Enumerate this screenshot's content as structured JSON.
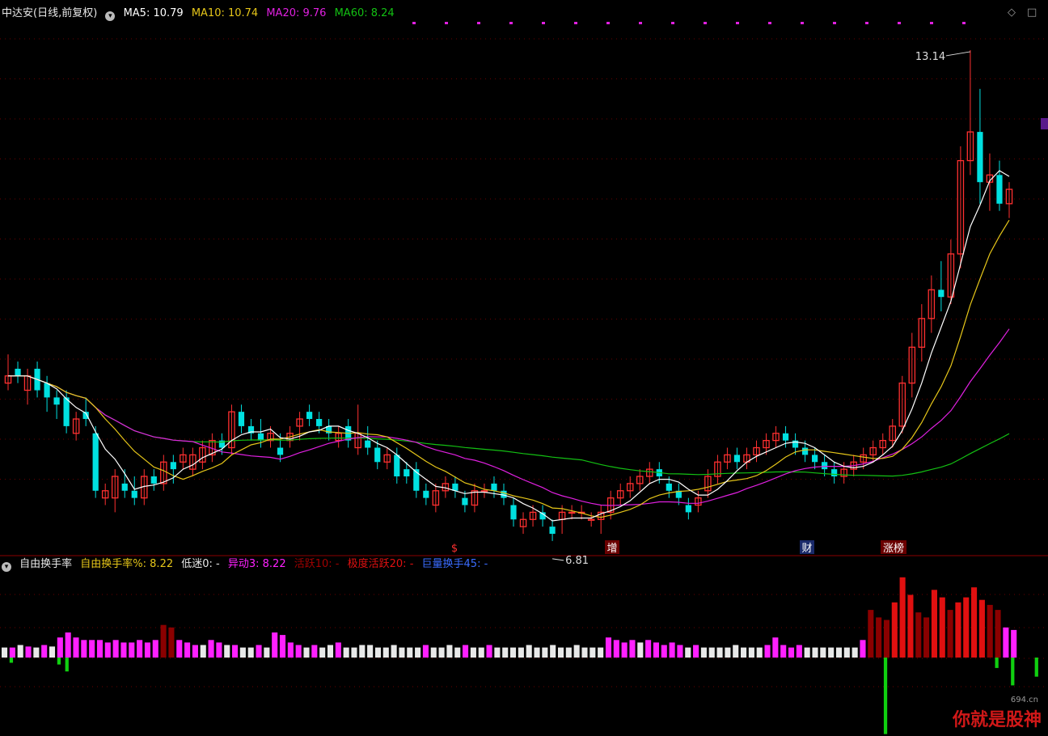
{
  "header": {
    "stock": "中达安(日线,前复权)",
    "ma5": "MA5: 10.79",
    "ma10": "MA10: 10.74",
    "ma20": "MA20: 9.76",
    "ma60": "MA60: 8.24"
  },
  "sub_header": {
    "indicator": "自由换手率",
    "rate": "自由换手率%: 8.22",
    "low": "低迷0: -",
    "abnormal": "异动3: 8.22",
    "active": "活跃10: -",
    "very_active": "极度活跃20: -",
    "huge": "巨量换手45: -"
  },
  "annotations": {
    "high": "13.14",
    "low": "6.81",
    "events": [
      "$",
      "增",
      "财",
      "涨榜"
    ]
  },
  "controls": {
    "diamond": "◇",
    "window": "□"
  },
  "watermark": {
    "text": "你就是股神",
    "site": "694.cn"
  },
  "colors": {
    "bg": "#000000",
    "up": "#ff3030",
    "down": "#00e0e0",
    "ma5": "#ffffff",
    "ma10": "#e6c619",
    "ma20": "#e020e0",
    "ma60": "#13c013",
    "grid": "#6a0000",
    "turnover_magenta": "#ff20ff",
    "turnover_white": "#e8e8e8",
    "turnover_darkred": "#8b0000",
    "turnover_red": "#e01010"
  },
  "chart_data": {
    "type": "candlestick",
    "price_ylim": [
      6.4,
      13.5
    ],
    "candles": [
      {
        "o": 8.5,
        "h": 8.9,
        "l": 8.4,
        "c": 8.6
      },
      {
        "o": 8.7,
        "h": 8.8,
        "l": 8.5,
        "c": 8.6
      },
      {
        "o": 8.4,
        "h": 8.7,
        "l": 8.2,
        "c": 8.6
      },
      {
        "o": 8.7,
        "h": 8.8,
        "l": 8.3,
        "c": 8.4
      },
      {
        "o": 8.5,
        "h": 8.6,
        "l": 8.1,
        "c": 8.3
      },
      {
        "o": 8.3,
        "h": 8.4,
        "l": 8.0,
        "c": 8.2
      },
      {
        "o": 8.3,
        "h": 8.4,
        "l": 7.8,
        "c": 7.9
      },
      {
        "o": 7.8,
        "h": 8.1,
        "l": 7.7,
        "c": 8.0
      },
      {
        "o": 8.1,
        "h": 8.3,
        "l": 7.9,
        "c": 8.0
      },
      {
        "o": 7.8,
        "h": 7.9,
        "l": 6.9,
        "c": 7.0
      },
      {
        "o": 6.9,
        "h": 7.1,
        "l": 6.8,
        "c": 7.0
      },
      {
        "o": 6.9,
        "h": 7.3,
        "l": 6.7,
        "c": 7.2
      },
      {
        "o": 7.1,
        "h": 7.3,
        "l": 6.9,
        "c": 7.0
      },
      {
        "o": 7.0,
        "h": 7.2,
        "l": 6.8,
        "c": 6.9
      },
      {
        "o": 6.9,
        "h": 7.3,
        "l": 6.8,
        "c": 7.2
      },
      {
        "o": 7.2,
        "h": 7.3,
        "l": 7.0,
        "c": 7.1
      },
      {
        "o": 7.1,
        "h": 7.5,
        "l": 7.0,
        "c": 7.4
      },
      {
        "o": 7.4,
        "h": 7.5,
        "l": 7.1,
        "c": 7.3
      },
      {
        "o": 7.4,
        "h": 7.6,
        "l": 7.3,
        "c": 7.5
      },
      {
        "o": 7.3,
        "h": 7.6,
        "l": 7.2,
        "c": 7.5
      },
      {
        "o": 7.4,
        "h": 7.7,
        "l": 7.3,
        "c": 7.6
      },
      {
        "o": 7.5,
        "h": 7.8,
        "l": 7.4,
        "c": 7.7
      },
      {
        "o": 7.7,
        "h": 7.8,
        "l": 7.5,
        "c": 7.6
      },
      {
        "o": 7.6,
        "h": 8.2,
        "l": 7.5,
        "c": 8.1
      },
      {
        "o": 8.1,
        "h": 8.2,
        "l": 7.8,
        "c": 7.9
      },
      {
        "o": 7.9,
        "h": 8.0,
        "l": 7.7,
        "c": 7.8
      },
      {
        "o": 7.8,
        "h": 8.0,
        "l": 7.6,
        "c": 7.7
      },
      {
        "o": 7.7,
        "h": 7.9,
        "l": 7.6,
        "c": 7.8
      },
      {
        "o": 7.6,
        "h": 7.8,
        "l": 7.4,
        "c": 7.5
      },
      {
        "o": 7.7,
        "h": 7.9,
        "l": 7.6,
        "c": 7.8
      },
      {
        "o": 7.9,
        "h": 8.1,
        "l": 7.7,
        "c": 8.0
      },
      {
        "o": 8.1,
        "h": 8.2,
        "l": 7.9,
        "c": 8.0
      },
      {
        "o": 8.0,
        "h": 8.1,
        "l": 7.8,
        "c": 7.9
      },
      {
        "o": 7.9,
        "h": 8.0,
        "l": 7.7,
        "c": 7.8
      },
      {
        "o": 7.7,
        "h": 7.9,
        "l": 7.6,
        "c": 7.8
      },
      {
        "o": 7.9,
        "h": 8.0,
        "l": 7.6,
        "c": 7.7
      },
      {
        "o": 7.6,
        "h": 8.2,
        "l": 7.5,
        "c": 7.8
      },
      {
        "o": 7.7,
        "h": 7.9,
        "l": 7.5,
        "c": 7.6
      },
      {
        "o": 7.6,
        "h": 7.7,
        "l": 7.3,
        "c": 7.4
      },
      {
        "o": 7.4,
        "h": 7.6,
        "l": 7.3,
        "c": 7.5
      },
      {
        "o": 7.5,
        "h": 7.6,
        "l": 7.1,
        "c": 7.2
      },
      {
        "o": 7.3,
        "h": 7.4,
        "l": 7.1,
        "c": 7.2
      },
      {
        "o": 7.3,
        "h": 7.4,
        "l": 6.9,
        "c": 7.0
      },
      {
        "o": 7.0,
        "h": 7.1,
        "l": 6.8,
        "c": 6.9
      },
      {
        "o": 6.8,
        "h": 7.1,
        "l": 6.7,
        "c": 7.0
      },
      {
        "o": 7.0,
        "h": 7.2,
        "l": 6.9,
        "c": 7.1
      },
      {
        "o": 7.1,
        "h": 7.2,
        "l": 6.9,
        "c": 7.0
      },
      {
        "o": 6.9,
        "h": 7.0,
        "l": 6.7,
        "c": 6.8
      },
      {
        "o": 6.8,
        "h": 7.1,
        "l": 6.7,
        "c": 7.0
      },
      {
        "o": 7.0,
        "h": 7.1,
        "l": 6.9,
        "c": 7.0
      },
      {
        "o": 7.1,
        "h": 7.2,
        "l": 6.9,
        "c": 7.0
      },
      {
        "o": 7.0,
        "h": 7.1,
        "l": 6.8,
        "c": 6.9
      },
      {
        "o": 6.8,
        "h": 6.9,
        "l": 6.5,
        "c": 6.6
      },
      {
        "o": 6.5,
        "h": 6.7,
        "l": 6.4,
        "c": 6.6
      },
      {
        "o": 6.6,
        "h": 6.8,
        "l": 6.5,
        "c": 6.7
      },
      {
        "o": 6.7,
        "h": 6.8,
        "l": 6.5,
        "c": 6.6
      },
      {
        "o": 6.5,
        "h": 6.6,
        "l": 6.3,
        "c": 6.4
      },
      {
        "o": 6.6,
        "h": 6.8,
        "l": 6.4,
        "c": 6.7
      },
      {
        "o": 6.7,
        "h": 6.8,
        "l": 6.6,
        "c": 6.7
      },
      {
        "o": 6.7,
        "h": 6.8,
        "l": 6.6,
        "c": 6.7
      },
      {
        "o": 6.6,
        "h": 6.7,
        "l": 6.5,
        "c": 6.6
      },
      {
        "o": 6.6,
        "h": 6.8,
        "l": 6.4,
        "c": 6.7
      },
      {
        "o": 6.7,
        "h": 7.0,
        "l": 6.6,
        "c": 6.9
      },
      {
        "o": 6.9,
        "h": 7.1,
        "l": 6.8,
        "c": 7.0
      },
      {
        "o": 7.0,
        "h": 7.2,
        "l": 6.9,
        "c": 7.1
      },
      {
        "o": 7.1,
        "h": 7.3,
        "l": 7.0,
        "c": 7.2
      },
      {
        "o": 7.2,
        "h": 7.4,
        "l": 7.1,
        "c": 7.3
      },
      {
        "o": 7.3,
        "h": 7.4,
        "l": 7.1,
        "c": 7.2
      },
      {
        "o": 7.1,
        "h": 7.2,
        "l": 6.9,
        "c": 7.0
      },
      {
        "o": 7.0,
        "h": 7.1,
        "l": 6.8,
        "c": 6.9
      },
      {
        "o": 6.8,
        "h": 6.9,
        "l": 6.6,
        "c": 6.7
      },
      {
        "o": 6.8,
        "h": 7.0,
        "l": 6.7,
        "c": 6.9
      }
    ],
    "candles_right": [
      {
        "o": 7.0,
        "h": 7.3,
        "l": 6.9,
        "c": 7.2
      },
      {
        "o": 7.2,
        "h": 7.5,
        "l": 7.1,
        "c": 7.4
      },
      {
        "o": 7.4,
        "h": 7.6,
        "l": 7.3,
        "c": 7.5
      },
      {
        "o": 7.5,
        "h": 7.6,
        "l": 7.3,
        "c": 7.4
      },
      {
        "o": 7.4,
        "h": 7.6,
        "l": 7.3,
        "c": 7.5
      },
      {
        "o": 7.5,
        "h": 7.7,
        "l": 7.4,
        "c": 7.6
      },
      {
        "o": 7.6,
        "h": 7.8,
        "l": 7.5,
        "c": 7.7
      },
      {
        "o": 7.7,
        "h": 7.9,
        "l": 7.6,
        "c": 7.8
      },
      {
        "o": 7.8,
        "h": 7.9,
        "l": 7.6,
        "c": 7.7
      },
      {
        "o": 7.7,
        "h": 7.8,
        "l": 7.5,
        "c": 7.6
      },
      {
        "o": 7.6,
        "h": 7.7,
        "l": 7.4,
        "c": 7.5
      },
      {
        "o": 7.5,
        "h": 7.6,
        "l": 7.3,
        "c": 7.4
      },
      {
        "o": 7.4,
        "h": 7.5,
        "l": 7.2,
        "c": 7.3
      },
      {
        "o": 7.3,
        "h": 7.4,
        "l": 7.1,
        "c": 7.2
      },
      {
        "o": 7.2,
        "h": 7.4,
        "l": 7.1,
        "c": 7.3
      },
      {
        "o": 7.3,
        "h": 7.5,
        "l": 7.2,
        "c": 7.4
      },
      {
        "o": 7.4,
        "h": 7.6,
        "l": 7.3,
        "c": 7.5
      },
      {
        "o": 7.5,
        "h": 7.7,
        "l": 7.4,
        "c": 7.6
      },
      {
        "o": 7.6,
        "h": 7.8,
        "l": 7.5,
        "c": 7.7
      },
      {
        "o": 7.7,
        "h": 8.0,
        "l": 7.6,
        "c": 7.9
      },
      {
        "o": 7.9,
        "h": 8.6,
        "l": 7.8,
        "c": 8.5
      },
      {
        "o": 8.5,
        "h": 9.2,
        "l": 8.3,
        "c": 9.0
      },
      {
        "o": 9.0,
        "h": 9.6,
        "l": 8.8,
        "c": 9.4
      },
      {
        "o": 9.4,
        "h": 10.0,
        "l": 9.2,
        "c": 9.8
      },
      {
        "o": 9.8,
        "h": 10.2,
        "l": 9.5,
        "c": 9.7
      },
      {
        "o": 9.7,
        "h": 10.5,
        "l": 9.6,
        "c": 10.3
      },
      {
        "o": 10.3,
        "h": 11.8,
        "l": 10.1,
        "c": 11.6
      },
      {
        "o": 11.6,
        "h": 13.14,
        "l": 11.4,
        "c": 12.0
      },
      {
        "o": 12.0,
        "h": 12.6,
        "l": 11.0,
        "c": 11.3
      },
      {
        "o": 11.3,
        "h": 11.7,
        "l": 10.9,
        "c": 11.4
      },
      {
        "o": 11.4,
        "h": 11.6,
        "l": 10.9,
        "c": 11.0
      },
      {
        "o": 11.0,
        "h": 11.3,
        "l": 10.8,
        "c": 11.2
      }
    ],
    "turnover": [
      {
        "v": 2.0,
        "k": "w"
      },
      {
        "v": 2.0,
        "k": "m"
      },
      {
        "v": 2.5,
        "k": "w"
      },
      {
        "v": 2.2,
        "k": "m"
      },
      {
        "v": 2.0,
        "k": "w"
      },
      {
        "v": 2.5,
        "k": "m"
      },
      {
        "v": 2.2,
        "k": "w"
      },
      {
        "v": 4.0,
        "k": "m"
      },
      {
        "v": 5.0,
        "k": "m"
      },
      {
        "v": 4.0,
        "k": "m"
      },
      {
        "v": 3.5,
        "k": "m"
      },
      {
        "v": 3.5,
        "k": "m"
      },
      {
        "v": 3.5,
        "k": "m"
      },
      {
        "v": 3.0,
        "k": "m"
      },
      {
        "v": 3.5,
        "k": "m"
      },
      {
        "v": 3.0,
        "k": "m"
      },
      {
        "v": 3.0,
        "k": "m"
      },
      {
        "v": 3.5,
        "k": "m"
      },
      {
        "v": 3.0,
        "k": "m"
      },
      {
        "v": 3.5,
        "k": "m"
      },
      {
        "v": 6.5,
        "k": "d"
      },
      {
        "v": 6.0,
        "k": "d"
      },
      {
        "v": 3.5,
        "k": "m"
      },
      {
        "v": 3.0,
        "k": "m"
      },
      {
        "v": 2.5,
        "k": "m"
      },
      {
        "v": 2.5,
        "k": "w"
      },
      {
        "v": 3.5,
        "k": "m"
      },
      {
        "v": 3.0,
        "k": "m"
      },
      {
        "v": 2.5,
        "k": "w"
      },
      {
        "v": 2.5,
        "k": "m"
      },
      {
        "v": 2.0,
        "k": "w"
      },
      {
        "v": 2.0,
        "k": "w"
      },
      {
        "v": 2.5,
        "k": "m"
      },
      {
        "v": 2.0,
        "k": "w"
      },
      {
        "v": 5.0,
        "k": "m"
      },
      {
        "v": 4.5,
        "k": "m"
      },
      {
        "v": 3.0,
        "k": "m"
      },
      {
        "v": 2.5,
        "k": "m"
      },
      {
        "v": 2.0,
        "k": "w"
      },
      {
        "v": 2.5,
        "k": "m"
      },
      {
        "v": 2.0,
        "k": "w"
      },
      {
        "v": 2.5,
        "k": "w"
      },
      {
        "v": 3.0,
        "k": "m"
      },
      {
        "v": 2.0,
        "k": "w"
      },
      {
        "v": 2.0,
        "k": "w"
      },
      {
        "v": 2.5,
        "k": "w"
      },
      {
        "v": 2.5,
        "k": "w"
      },
      {
        "v": 2.0,
        "k": "w"
      },
      {
        "v": 2.0,
        "k": "w"
      },
      {
        "v": 2.5,
        "k": "w"
      },
      {
        "v": 2.0,
        "k": "w"
      },
      {
        "v": 2.0,
        "k": "w"
      },
      {
        "v": 2.0,
        "k": "w"
      },
      {
        "v": 2.5,
        "k": "m"
      },
      {
        "v": 2.0,
        "k": "w"
      },
      {
        "v": 2.0,
        "k": "w"
      },
      {
        "v": 2.5,
        "k": "w"
      },
      {
        "v": 2.0,
        "k": "w"
      },
      {
        "v": 2.5,
        "k": "m"
      },
      {
        "v": 2.0,
        "k": "w"
      },
      {
        "v": 2.0,
        "k": "w"
      },
      {
        "v": 2.5,
        "k": "m"
      },
      {
        "v": 2.0,
        "k": "w"
      },
      {
        "v": 2.0,
        "k": "w"
      },
      {
        "v": 2.0,
        "k": "w"
      },
      {
        "v": 2.0,
        "k": "w"
      },
      {
        "v": 2.5,
        "k": "w"
      },
      {
        "v": 2.0,
        "k": "w"
      },
      {
        "v": 2.0,
        "k": "w"
      },
      {
        "v": 2.5,
        "k": "w"
      },
      {
        "v": 2.0,
        "k": "w"
      },
      {
        "v": 2.0,
        "k": "w"
      },
      {
        "v": 2.5,
        "k": "w"
      },
      {
        "v": 2.0,
        "k": "w"
      },
      {
        "v": 2.0,
        "k": "w"
      },
      {
        "v": 2.0,
        "k": "w"
      },
      {
        "v": 4.0,
        "k": "m"
      },
      {
        "v": 3.5,
        "k": "m"
      },
      {
        "v": 3.0,
        "k": "m"
      },
      {
        "v": 3.5,
        "k": "m"
      },
      {
        "v": 3.0,
        "k": "w"
      },
      {
        "v": 3.5,
        "k": "m"
      },
      {
        "v": 3.0,
        "k": "m"
      },
      {
        "v": 2.5,
        "k": "m"
      },
      {
        "v": 3.0,
        "k": "m"
      },
      {
        "v": 2.5,
        "k": "m"
      },
      {
        "v": 2.0,
        "k": "w"
      },
      {
        "v": 2.5,
        "k": "m"
      },
      {
        "v": 2.0,
        "k": "w"
      },
      {
        "v": 2.0,
        "k": "w"
      },
      {
        "v": 2.0,
        "k": "w"
      },
      {
        "v": 2.0,
        "k": "w"
      },
      {
        "v": 2.5,
        "k": "w"
      },
      {
        "v": 2.0,
        "k": "w"
      },
      {
        "v": 2.0,
        "k": "w"
      },
      {
        "v": 2.0,
        "k": "w"
      },
      {
        "v": 2.5,
        "k": "m"
      },
      {
        "v": 4.0,
        "k": "m"
      },
      {
        "v": 2.5,
        "k": "m"
      },
      {
        "v": 2.0,
        "k": "m"
      },
      {
        "v": 2.5,
        "k": "m"
      },
      {
        "v": 2.0,
        "k": "w"
      },
      {
        "v": 2.0,
        "k": "w"
      },
      {
        "v": 2.0,
        "k": "w"
      },
      {
        "v": 2.0,
        "k": "w"
      },
      {
        "v": 2.0,
        "k": "w"
      },
      {
        "v": 2.0,
        "k": "w"
      },
      {
        "v": 2.0,
        "k": "w"
      },
      {
        "v": 3.5,
        "k": "m"
      },
      {
        "v": 9.5,
        "k": "d"
      },
      {
        "v": 8.0,
        "k": "d"
      },
      {
        "v": 7.5,
        "k": "d"
      },
      {
        "v": 11.0,
        "k": "r"
      },
      {
        "v": 16.0,
        "k": "r"
      },
      {
        "v": 12.5,
        "k": "r"
      },
      {
        "v": 9.0,
        "k": "d"
      },
      {
        "v": 8.0,
        "k": "d"
      },
      {
        "v": 13.5,
        "k": "r"
      },
      {
        "v": 12.0,
        "k": "r"
      },
      {
        "v": 9.5,
        "k": "d"
      },
      {
        "v": 11.0,
        "k": "r"
      },
      {
        "v": 12.0,
        "k": "r"
      },
      {
        "v": 14.0,
        "k": "r"
      },
      {
        "v": 11.5,
        "k": "r"
      },
      {
        "v": 10.5,
        "k": "d"
      },
      {
        "v": 9.5,
        "k": "d"
      },
      {
        "v": 6.0,
        "k": "m"
      },
      {
        "v": 5.5,
        "k": "m"
      }
    ],
    "green_spikes": [
      {
        "idx": 1,
        "v": 1.5
      },
      {
        "idx": 7,
        "v": 2.0
      },
      {
        "idx": 8,
        "v": 4.0
      },
      {
        "idx": 111,
        "v": 22.0
      },
      {
        "idx": 125,
        "v": 3.0
      },
      {
        "idx": 127,
        "v": 8.0
      },
      {
        "idx": 130,
        "v": 5.5
      }
    ]
  }
}
